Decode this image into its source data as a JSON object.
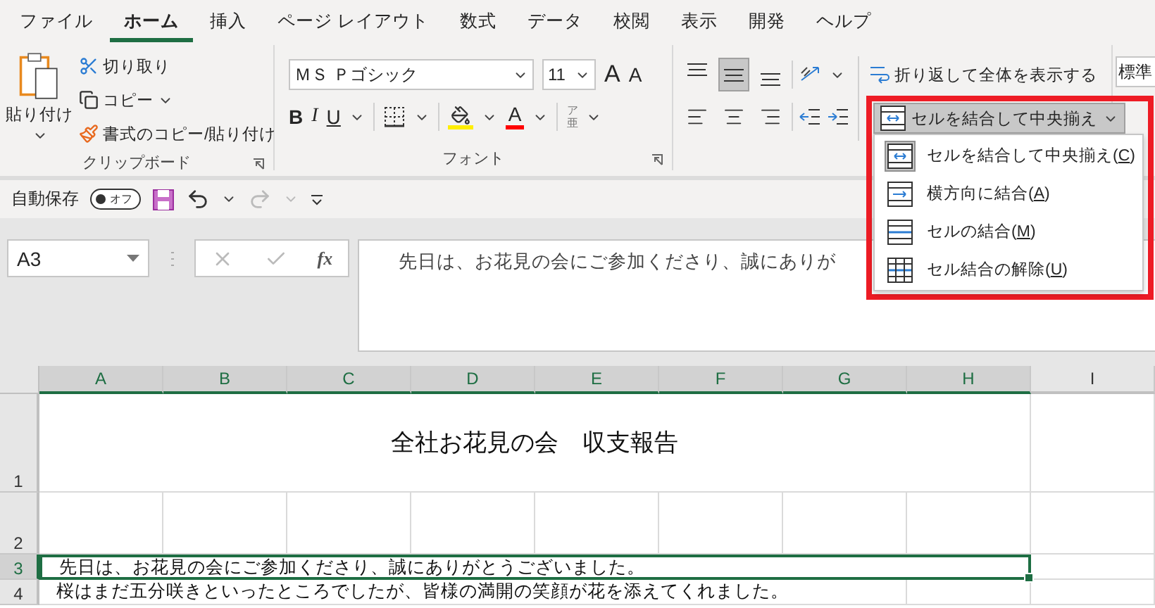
{
  "tabs": [
    {
      "label": "ファイル",
      "selected": false
    },
    {
      "label": "ホーム",
      "selected": true
    },
    {
      "label": "挿入",
      "selected": false
    },
    {
      "label": "ページ レイアウト",
      "selected": false
    },
    {
      "label": "数式",
      "selected": false
    },
    {
      "label": "データ",
      "selected": false
    },
    {
      "label": "校閲",
      "selected": false
    },
    {
      "label": "表示",
      "selected": false
    },
    {
      "label": "開発",
      "selected": false
    },
    {
      "label": "ヘルプ",
      "selected": false
    }
  ],
  "clipboard": {
    "paste": "貼り付け",
    "cut": "切り取り",
    "copy": "コピー",
    "format_painter": "書式のコピー/貼り付け",
    "group_label": "クリップボード"
  },
  "font": {
    "name": "ＭＳ Ｐゴシック",
    "size": "11",
    "grow": "A",
    "shrink": "A",
    "bold": "B",
    "italic": "I",
    "underline": "U",
    "font_color": "A",
    "phonetic_top": "ア",
    "phonetic_bottom": "亜",
    "group_label": "フォント"
  },
  "alignment": {
    "vertical": [
      {
        "kind": "top",
        "selected": false
      },
      {
        "kind": "middle",
        "selected": true
      },
      {
        "kind": "bottom",
        "selected": false
      }
    ],
    "horizontal": [
      {
        "kind": "left",
        "selected": false
      },
      {
        "kind": "center",
        "selected": false
      },
      {
        "kind": "right",
        "selected": false
      }
    ],
    "wrap_text": "折り返して全体を表示する",
    "merge_button": "セルを結合して中央揃え",
    "merge_pressed": true
  },
  "number": {
    "format": "標準"
  },
  "quick_access": {
    "autosave": "自動保存",
    "toggle": "オフ",
    "on": false
  },
  "formula_bar": {
    "name_box": "A3",
    "fx": "fx",
    "formula": "先日は、お花見の会にご参加くださり、誠にありが"
  },
  "sheet": {
    "columns": [
      {
        "label": "A",
        "selected": true
      },
      {
        "label": "B",
        "selected": true
      },
      {
        "label": "C",
        "selected": true
      },
      {
        "label": "D",
        "selected": true
      },
      {
        "label": "E",
        "selected": true
      },
      {
        "label": "F",
        "selected": true
      },
      {
        "label": "G",
        "selected": true
      },
      {
        "label": "H",
        "selected": true
      },
      {
        "label": "I",
        "selected": false
      }
    ],
    "rows": [
      {
        "number": "1",
        "kind": "title",
        "text": "全社お花見の会　収支報告",
        "selected": false
      },
      {
        "number": "2",
        "kind": "empty",
        "selected": false
      },
      {
        "number": "3",
        "kind": "merged",
        "text": "先日は、お花見の会にご参加くださり、誠にありがとうございました。",
        "selected": true
      },
      {
        "number": "4",
        "kind": "overflow",
        "text": "桜はまだ五分咲きといったところでしたが、皆様の満開の笑顔が花を添えてくれました。",
        "selected": false
      }
    ]
  },
  "merge_menu": {
    "items": [
      {
        "kind": "merge-center",
        "before": "セルを結合して中央揃え(",
        "key": "C",
        "after": ")",
        "selected": true
      },
      {
        "kind": "merge-across",
        "before": "横方向に結合(",
        "key": "A",
        "after": ")",
        "selected": false
      },
      {
        "kind": "merge",
        "before": "セルの結合(",
        "key": "M",
        "after": ")",
        "selected": false
      },
      {
        "kind": "unmerge",
        "before": "セル結合の解除(",
        "key": "U",
        "after": ")",
        "selected": false
      }
    ]
  }
}
